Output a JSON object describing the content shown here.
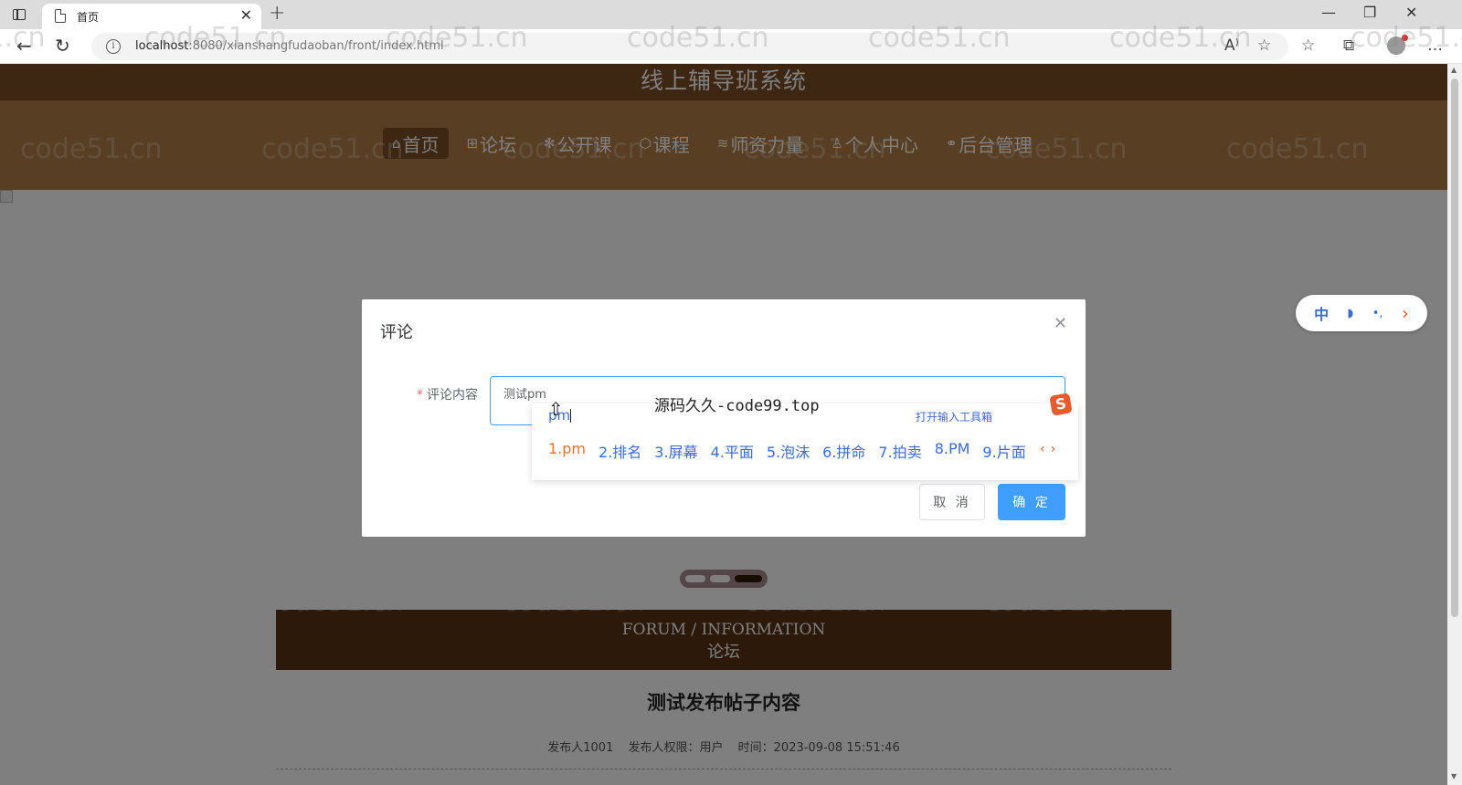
{
  "browser": {
    "tab_title": "首页",
    "url_host": "localhost",
    "url_path": ":8080/xianshangfudaoban/front/index.html"
  },
  "site": {
    "title": "线上辅导班系统",
    "nav": [
      {
        "label": "首页",
        "icon": "home-icon",
        "glyph": "⌂"
      },
      {
        "label": "论坛",
        "icon": "forum-icon",
        "glyph": "⊞"
      },
      {
        "label": "公开课",
        "icon": "snowflake-icon",
        "glyph": "✻"
      },
      {
        "label": "课程",
        "icon": "cube-icon",
        "glyph": "⬡"
      },
      {
        "label": "师资力量",
        "icon": "layers-icon",
        "glyph": "≋"
      },
      {
        "label": "个人中心",
        "icon": "user-icon",
        "glyph": "♙"
      },
      {
        "label": "后台管理",
        "icon": "link-icon",
        "glyph": "⚭"
      }
    ],
    "active_nav_index": 0
  },
  "forum_section": {
    "title_en": "FORUM / INFORMATION",
    "title_cn": "论坛"
  },
  "post": {
    "title": "测试发布帖子内容",
    "author": "发布人1001",
    "role": "发布人权限：用户",
    "time": "时间：2023-09-08 15:51:46"
  },
  "dialog": {
    "title": "评论",
    "label": "评论内容",
    "value": "测试pm",
    "cancel": "取 消",
    "confirm": "确 定"
  },
  "ime": {
    "composition": "pm",
    "toolbox": "打开输入工具箱",
    "candidates": [
      "1.pm",
      "2.排名",
      "3.屏幕",
      "4.平面",
      "5.泡沫",
      "6.拼命",
      "7.拍卖",
      "8.PM",
      "9.片面"
    ],
    "status_mode": "中",
    "promo": "源码久久-code99.top",
    "logo": "S"
  },
  "watermark": "code51.cn",
  "colors": {
    "header": "#7a4d25",
    "nav": "#b07d45",
    "banner": "#5a3312",
    "primary": "#409eff"
  }
}
